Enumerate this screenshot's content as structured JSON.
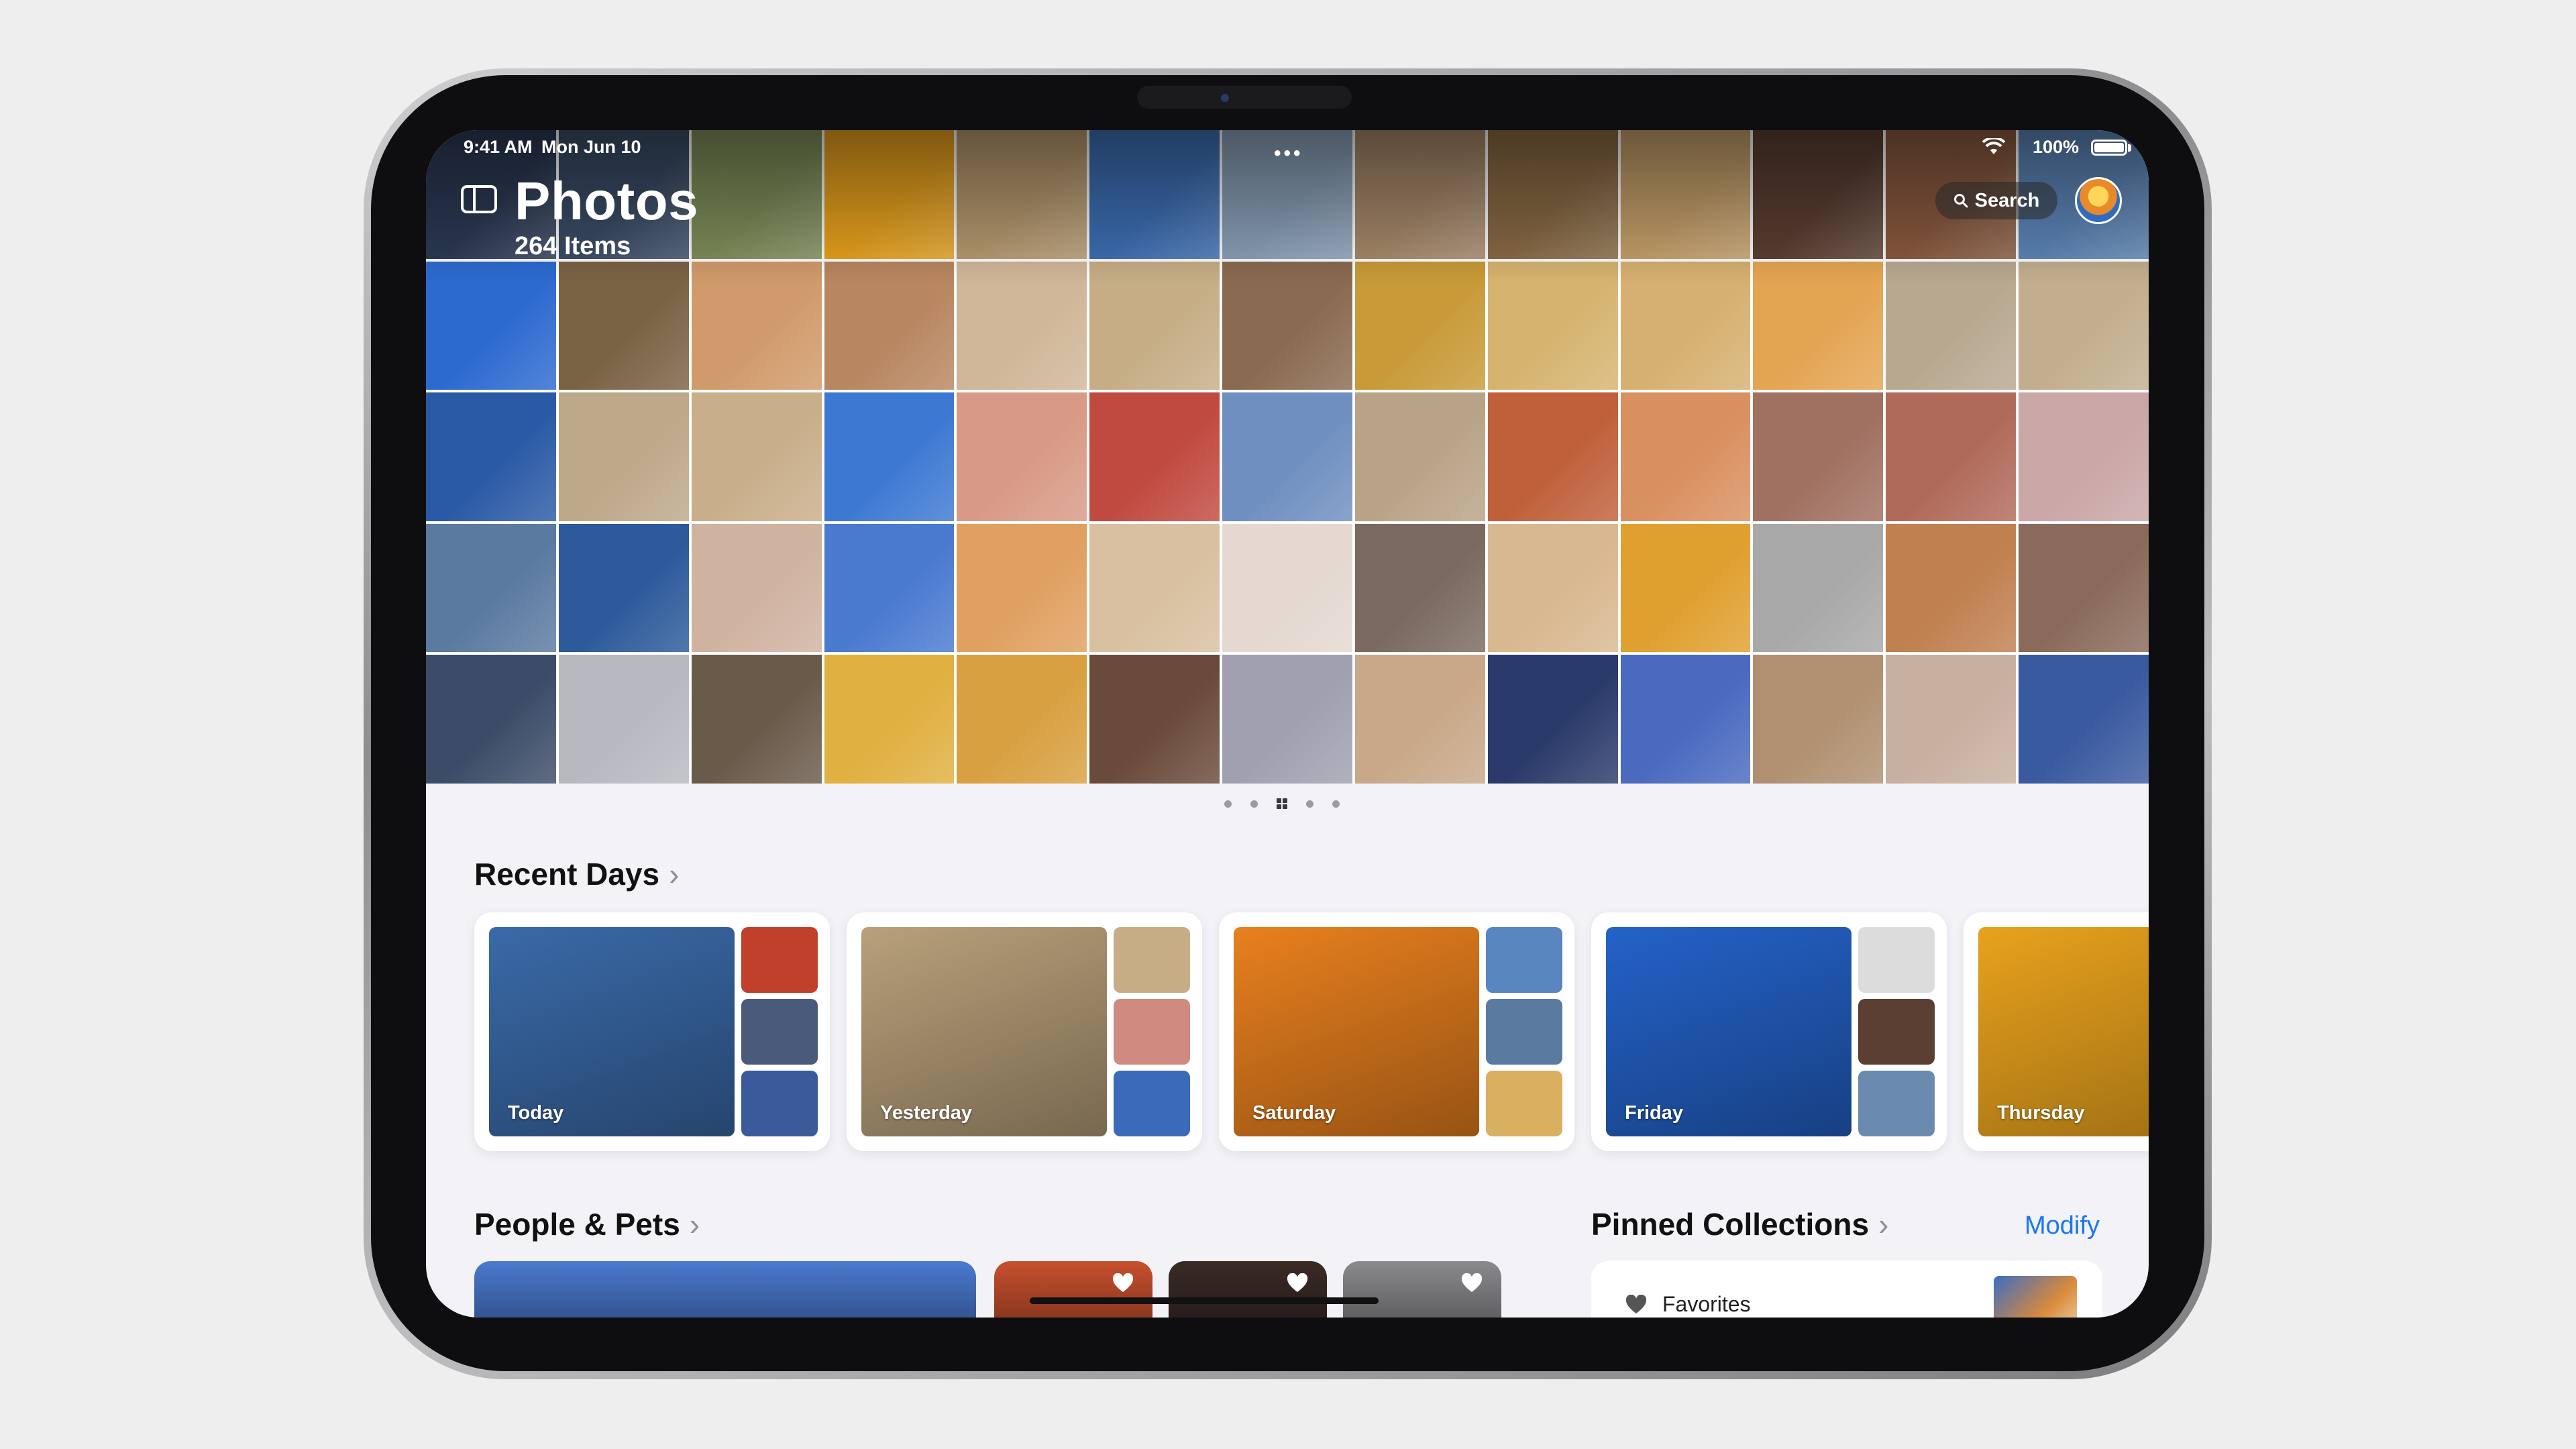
{
  "status_bar": {
    "time": "9:41 AM",
    "date": "Mon Jun 10",
    "battery": "100%"
  },
  "header": {
    "title": "Photos",
    "item_count": "264 Items",
    "search_label": "Search"
  },
  "photo_grid": {
    "tiles": [
      "#2c3a55",
      "#3a4c66",
      "#7f8f5a",
      "#e8a21d",
      "#b89a70",
      "#3d6fb5",
      "#8aa0b8",
      "#a7896a",
      "#8a6a45",
      "#c6a06a",
      "#5b3f32",
      "#8a5a3f",
      "#5d86b8",
      "#2d6ad0",
      "#7a6244",
      "#d09a6a",
      "#b88660",
      "#d0b698",
      "#c6ad86",
      "#8a6a50",
      "#c89a38",
      "#d6b470",
      "#d6b070",
      "#e4a552",
      "#b8a890",
      "#c2ae8e",
      "#2a5aa5",
      "#bda88a",
      "#c9ae8a",
      "#3d79d2",
      "#d89a86",
      "#c04a40",
      "#6f8fc0",
      "#b8a386",
      "#c0603a",
      "#d99060",
      "#a07060",
      "#b06a5a",
      "#caa6a6",
      "#5b7aa0",
      "#2c5a9a",
      "#d0b2a0",
      "#4a7ad0",
      "#e0a060",
      "#d8c0a0",
      "#e4d8d0",
      "#7a6a60",
      "#d8b890",
      "#e0a030",
      "#a8a8a8",
      "#c08050",
      "#8a6a5a",
      "#3c4c68",
      "#b8b8c0",
      "#6a5a4a",
      "#e0b040",
      "#d8a040",
      "#6a4a3a",
      "#a0a0b0",
      "#c8a888",
      "#2a3a6a",
      "#4a6ac0",
      "#b09070",
      "#c8b0a0",
      "#3a5aa0"
    ]
  },
  "pager": {
    "pages": 5,
    "current_page": 3
  },
  "recent_days": {
    "title": "Recent Days",
    "cards": [
      {
        "label": "Today",
        "main_color": "#3a6aa8",
        "thumbs": [
          "#c0402a",
          "#4a5a7a",
          "#3a5a9a"
        ]
      },
      {
        "label": "Yesterday",
        "main_color": "#b8a07a",
        "thumbs": [
          "#c6ad86",
          "#d08a80",
          "#3a6ab8"
        ]
      },
      {
        "label": "Saturday",
        "main_color": "#e8801e",
        "thumbs": [
          "#5a86c0",
          "#5b7aa0",
          "#d8b060"
        ]
      },
      {
        "label": "Friday",
        "main_color": "#2462c8",
        "thumbs": [
          "#dcdcdc",
          "#5b3f32",
          "#6a8ab0"
        ]
      },
      {
        "label": "Thursday",
        "main_color": "#e8a21d",
        "thumbs": []
      }
    ]
  },
  "people_pets": {
    "title": "People & Pets",
    "tiles": [
      {
        "color": "#4a7ad0",
        "favorite": false
      },
      {
        "color": "#c8502e",
        "favorite": true
      },
      {
        "color": "#3a2a26",
        "favorite": true
      },
      {
        "color": "#8a8a8e",
        "favorite": true
      }
    ]
  },
  "pinned_collections": {
    "title": "Pinned Collections",
    "modify_label": "Modify",
    "items": [
      {
        "label": "Favorites"
      }
    ]
  },
  "colors": {
    "accent": "#1a78f0",
    "background": "#f2f2f7"
  }
}
